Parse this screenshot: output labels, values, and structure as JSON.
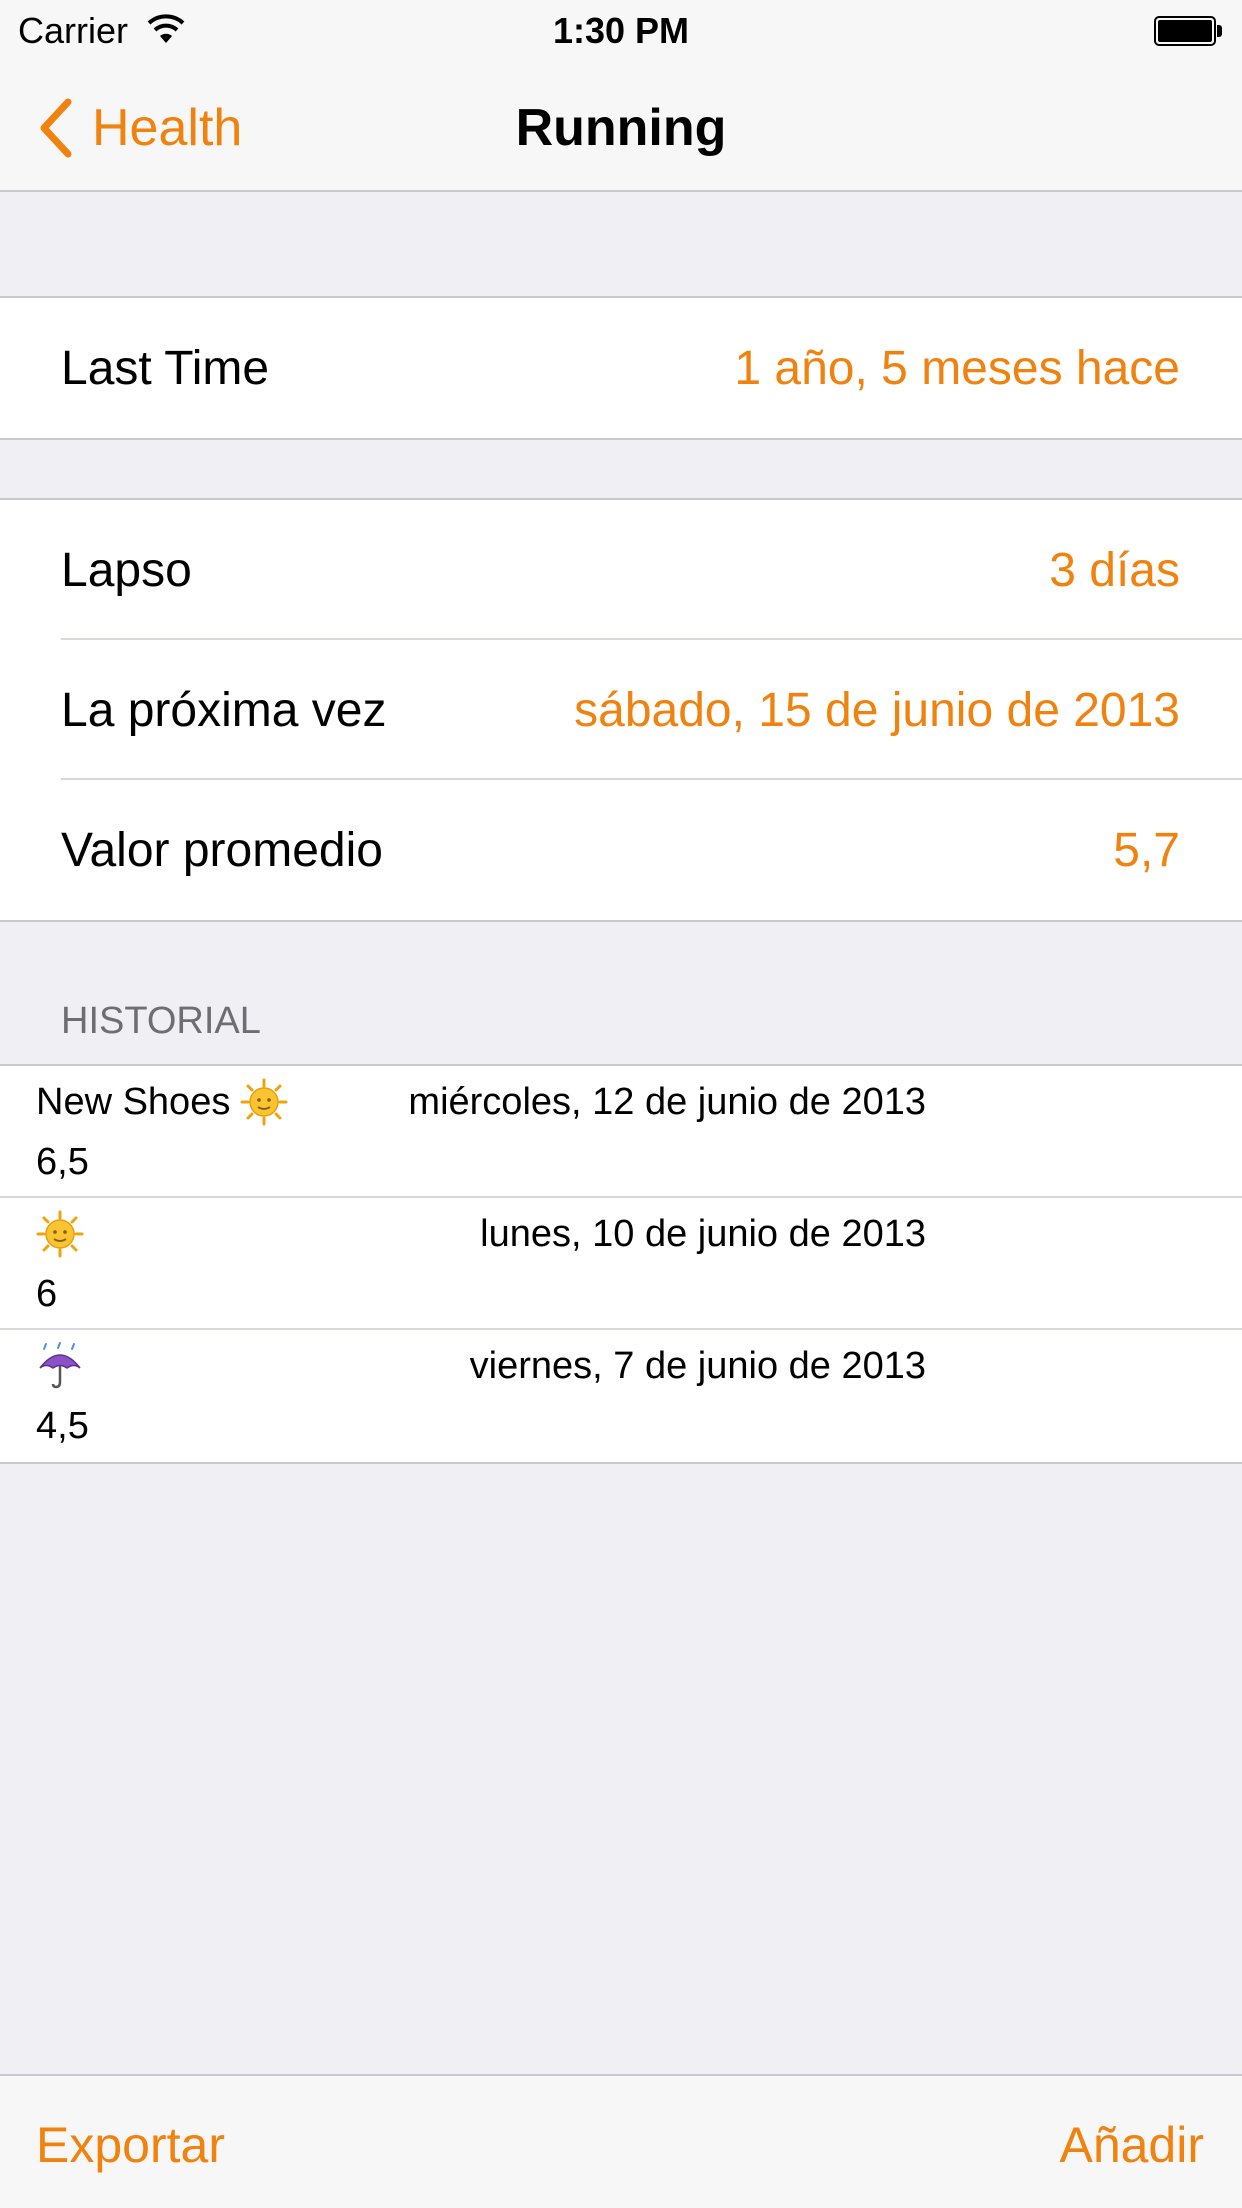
{
  "status_bar": {
    "carrier": "Carrier",
    "time": "1:30 PM"
  },
  "nav": {
    "back_label": "Health",
    "title": "Running"
  },
  "summary": {
    "last_time_label": "Last Time",
    "last_time_value": "1 año, 5 meses hace"
  },
  "stats": [
    {
      "label": "Lapso",
      "value": "3 días"
    },
    {
      "label": "La próxima vez",
      "value": "sábado, 15 de junio de 2013"
    },
    {
      "label": "Valor promedio",
      "value": "5,7"
    }
  ],
  "history": {
    "header": "HISTORIAL",
    "entries": [
      {
        "note": "New Shoes",
        "icon": "sun-face-icon",
        "date": "miércoles, 12 de junio de 2013",
        "value": "6,5"
      },
      {
        "note": "",
        "icon": "sun-icon",
        "date": "lunes, 10 de junio de 2013",
        "value": "6"
      },
      {
        "note": "",
        "icon": "umbrella-rain-icon",
        "date": "viernes, 7 de junio de 2013",
        "value": "4,5"
      }
    ]
  },
  "toolbar": {
    "export_label": "Exportar",
    "add_label": "Añadir"
  },
  "colors": {
    "accent": "#f0820f",
    "background": "#efeff4"
  }
}
